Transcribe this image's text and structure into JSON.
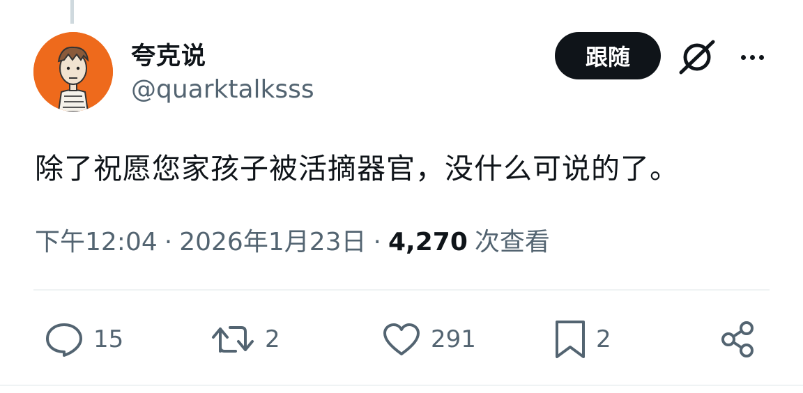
{
  "tweet": {
    "author_name": "夸克说",
    "author_handle": "@quarktalksss",
    "follow_label": "跟随",
    "text": "除了祝愿您家孩子被活摘器官，没什么可说的了。",
    "time": "下午12:04",
    "separator": "·",
    "date": "2026年1月23日",
    "views_count": "4,270",
    "views_label": "次查看"
  },
  "actions": {
    "reply_count": "15",
    "retweet_count": "2",
    "like_count": "291",
    "bookmark_count": "2"
  },
  "icons": [
    "grok-icon",
    "more-icon",
    "reply-icon",
    "retweet-icon",
    "like-icon",
    "bookmark-icon",
    "share-icon"
  ],
  "colors": {
    "text": "#0f1419",
    "secondary": "#536471",
    "avatar_bg": "#ee6a1c",
    "divider": "#eff3f4"
  }
}
